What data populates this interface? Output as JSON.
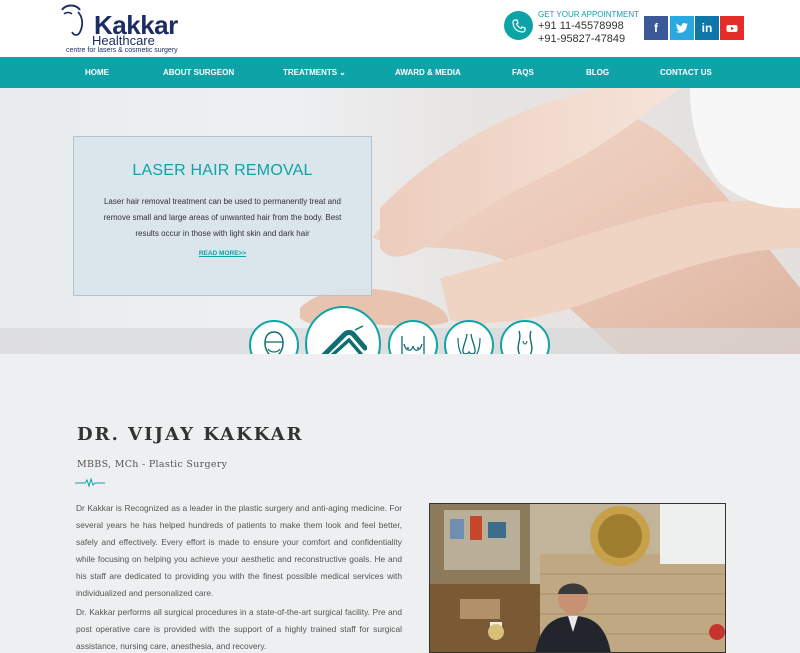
{
  "brand": {
    "logo_name": "Kakkar",
    "logo_sub": "Healthcare",
    "logo_tagline": "centre for lasers & cosmetic surgery"
  },
  "appointment": {
    "title": "GET YOUR APPOINTMENT",
    "phone1": "+91 11-45578998",
    "phone2": "+91-95827-47849"
  },
  "social": [
    {
      "name": "facebook",
      "glyph": "f",
      "color": "#3b5998"
    },
    {
      "name": "twitter",
      "glyph": "t",
      "color": "#2aa9e0"
    },
    {
      "name": "linkedin",
      "glyph": "in",
      "color": "#0e76a8"
    },
    {
      "name": "youtube",
      "glyph": "▶",
      "color": "#e52d27"
    }
  ],
  "nav": {
    "home": "HOME",
    "about": "ABOUT SURGEON",
    "treatments": "TREATMENTS",
    "awards": "AWARD & MEDIA",
    "faqs": "FAQS",
    "blog": "BLOG",
    "contact": "CONTACT US"
  },
  "hero": {
    "title": "LASER HAIR REMOVAL",
    "text": "Laser hair removal treatment can be used to permanently treat and remove small and large areas of unwanted hair from the body. Best results occur in those with light skin and dark hair",
    "link": "READ MORE>>"
  },
  "treatment_icons": [
    "face-treatment-icon",
    "laser-legs-icon",
    "breast-icon",
    "nose-icon",
    "body-contour-icon"
  ],
  "doctor": {
    "name": "DR. VIJAY KAKKAR",
    "degree": "MBBS, MCh - Plastic Surgery",
    "bio1": "Dr Kakkar is Recognized as a leader in the plastic surgery and anti-aging medicine. For several years he has helped hundreds of patients to make them look and feel better, safely and effectively. Every effort is made to ensure your comfort and confidentiality while focusing on helping you achieve your aesthetic and reconstructive goals. He and his staff are dedicated to providing you with the finest possible medical services with individualized and personalized care.",
    "bio2": "Dr. Kakkar performs all surgical procedures in a state-of-the-art surgical facility. Pre and post operative care is provided with the support of a highly trained staff for surgical assistance, nursing care, anesthesia, and recovery."
  },
  "colors": {
    "accent": "#0ea3a6",
    "brand": "#1d2d64"
  }
}
